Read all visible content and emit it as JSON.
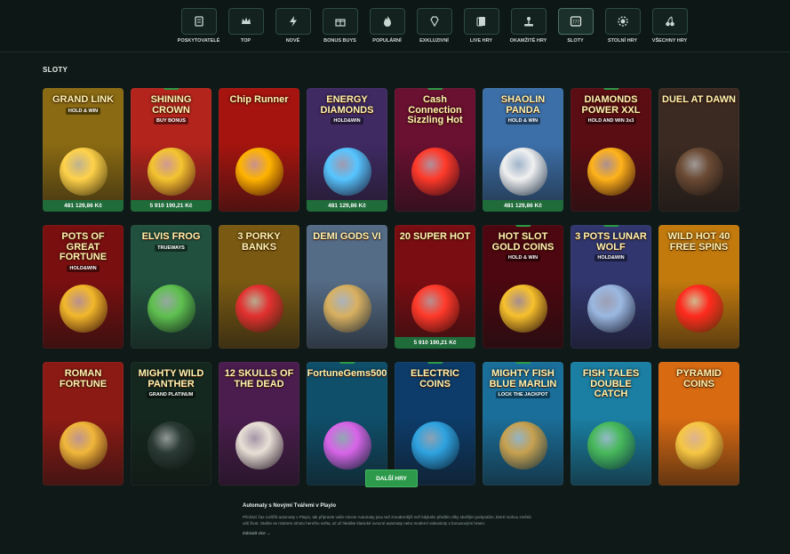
{
  "nav": [
    {
      "label": "POSKYTOVATELÉ",
      "icon": "providers-icon",
      "active": false
    },
    {
      "label": "TOP",
      "icon": "crown-icon",
      "active": false
    },
    {
      "label": "NOVÉ",
      "icon": "lightning-icon",
      "active": false
    },
    {
      "label": "BONUS BUYS",
      "icon": "gift-icon",
      "active": false
    },
    {
      "label": "POPULÁRNÍ",
      "icon": "flame-icon",
      "active": false
    },
    {
      "label": "EXKLUZIVNÍ",
      "icon": "diamond-icon",
      "active": false
    },
    {
      "label": "LIVE HRY",
      "icon": "cards-icon",
      "active": false
    },
    {
      "label": "OKAMŽITÉ HRY",
      "icon": "joystick-icon",
      "active": false
    },
    {
      "label": "SLOTY",
      "icon": "slot-icon",
      "active": true
    },
    {
      "label": "STOLNÍ HRY",
      "icon": "chip-icon",
      "active": false
    },
    {
      "label": "VŠECHNY HRY",
      "icon": "cherries-icon",
      "active": false
    }
  ],
  "section_title": "SLOTY",
  "games": [
    {
      "title": "GRAND LINK",
      "sub": "HOLD & WIN",
      "jackpot": "481 129,86 Kč",
      "badge": "",
      "bg": "#8a6a12",
      "art": "#ffd24a"
    },
    {
      "title": "SHINING CROWN",
      "sub": "BUY BONUS",
      "jackpot": "5 910 190,21 Kč",
      "badge": "nové",
      "bg": "#b3241c",
      "art": "#f4c430"
    },
    {
      "title": "Chip Runner",
      "sub": "",
      "jackpot": "",
      "badge": "",
      "bg": "#a5140f",
      "art": "#ffb400"
    },
    {
      "title": "ENERGY DIAMONDS",
      "sub": "HOLD&WIN",
      "jackpot": "481 129,86 Kč",
      "badge": "",
      "bg": "#3f2a62",
      "art": "#56c5ff"
    },
    {
      "title": "Cash Connection Sizzling Hot",
      "sub": "",
      "jackpot": "",
      "badge": "nové",
      "bg": "#6a1030",
      "art": "#ff3a2a"
    },
    {
      "title": "SHAOLIN PANDA",
      "sub": "HOLD & WIN",
      "jackpot": "481 129,86 Kč",
      "badge": "",
      "bg": "#3c6fa8",
      "art": "#f0f0f0"
    },
    {
      "title": "DIAMONDS POWER XXL",
      "sub": "HOLD AND WIN 3x3",
      "jackpot": "",
      "badge": "nové",
      "bg": "#5a0d13",
      "art": "#ffb21a"
    },
    {
      "title": "DUEL AT DAWN",
      "sub": "",
      "jackpot": "",
      "badge": "",
      "bg": "#3b2a22",
      "art": "#6a4a34"
    },
    {
      "title": "POTS OF GREAT FORTUNE",
      "sub": "HOLD&WIN",
      "jackpot": "",
      "badge": "",
      "bg": "#7a0f10",
      "art": "#f2b82a"
    },
    {
      "title": "ELVIS FROG",
      "sub": "TRUEWAYS",
      "jackpot": "",
      "badge": "",
      "bg": "#21503f",
      "art": "#5fc04f"
    },
    {
      "title": "3 PORKY BANKS",
      "sub": "",
      "jackpot": "",
      "badge": "",
      "bg": "#7a5a12",
      "art": "#e23030"
    },
    {
      "title": "DEMI GODS VI",
      "sub": "",
      "jackpot": "",
      "badge": "",
      "bg": "#556c86",
      "art": "#d8b060"
    },
    {
      "title": "20 SUPER HOT",
      "sub": "",
      "jackpot": "5 910 190,21 Kč",
      "badge": "",
      "bg": "#7a0d12",
      "art": "#ff3a2a"
    },
    {
      "title": "HOT SLOT GOLD COINS",
      "sub": "HOLD & WIN",
      "jackpot": "",
      "badge": "nové",
      "bg": "#4c0710",
      "art": "#f7c12c"
    },
    {
      "title": "3 POTS LUNAR WOLF",
      "sub": "HOLD&WIN",
      "jackpot": "",
      "badge": "nové",
      "bg": "#31366e",
      "art": "#9bb8e0"
    },
    {
      "title": "WILD HOT 40 FREE SPINS",
      "sub": "",
      "jackpot": "",
      "badge": "",
      "bg": "#c27a0d",
      "art": "#ff2a1e"
    },
    {
      "title": "ROMAN FORTUNE",
      "sub": "",
      "jackpot": "",
      "badge": "",
      "bg": "#8c1a14",
      "art": "#f0b73a"
    },
    {
      "title": "MIGHTY WILD PANTHER",
      "sub": "GRAND PLATINUM",
      "jackpot": "",
      "badge": "",
      "bg": "#14281f",
      "art": "#2b3a34"
    },
    {
      "title": "12 SKULLS OF THE DEAD",
      "sub": "",
      "jackpot": "",
      "badge": "",
      "bg": "#4a1d4e",
      "art": "#e8e0d6"
    },
    {
      "title": "FortuneGems500",
      "sub": "",
      "jackpot": "",
      "badge": "nové",
      "bg": "#0f4f6a",
      "art": "#d864e8"
    },
    {
      "title": "ELECTRIC COINS",
      "sub": "",
      "jackpot": "",
      "badge": "nové",
      "bg": "#0d3c6a",
      "art": "#2fa3e0"
    },
    {
      "title": "MIGHTY FISH BLUE MARLIN",
      "sub": "LOCK THE JACKPOT",
      "jackpot": "",
      "badge": "nové",
      "bg": "#1a6e9a",
      "art": "#c7a150"
    },
    {
      "title": "FISH TALES DOUBLE CATCH",
      "sub": "",
      "jackpot": "",
      "badge": "",
      "bg": "#1a7fa3",
      "art": "#47b85a"
    },
    {
      "title": "PYRAMID COINS",
      "sub": "",
      "jackpot": "",
      "badge": "",
      "bg": "#d86a12",
      "art": "#f6c744"
    }
  ],
  "more_button": "DALŠÍ HRY",
  "seo": {
    "title": "Automaty s Novými Tvářemi v Playio",
    "text": "Přichází čas rozšířit automaty v Playio, tak připravte vaše mince! Automaty jsou teď zmodernější než kdykoliv předtím díky skvělým jackpotům, které mohou změnit váš život. Staňte se mistrem tohoto herního světa, ať už hledáte klasické ovocné automaty nebo moderní videosloty s bonusovými hrami.",
    "link": "Zobrazit více →"
  }
}
